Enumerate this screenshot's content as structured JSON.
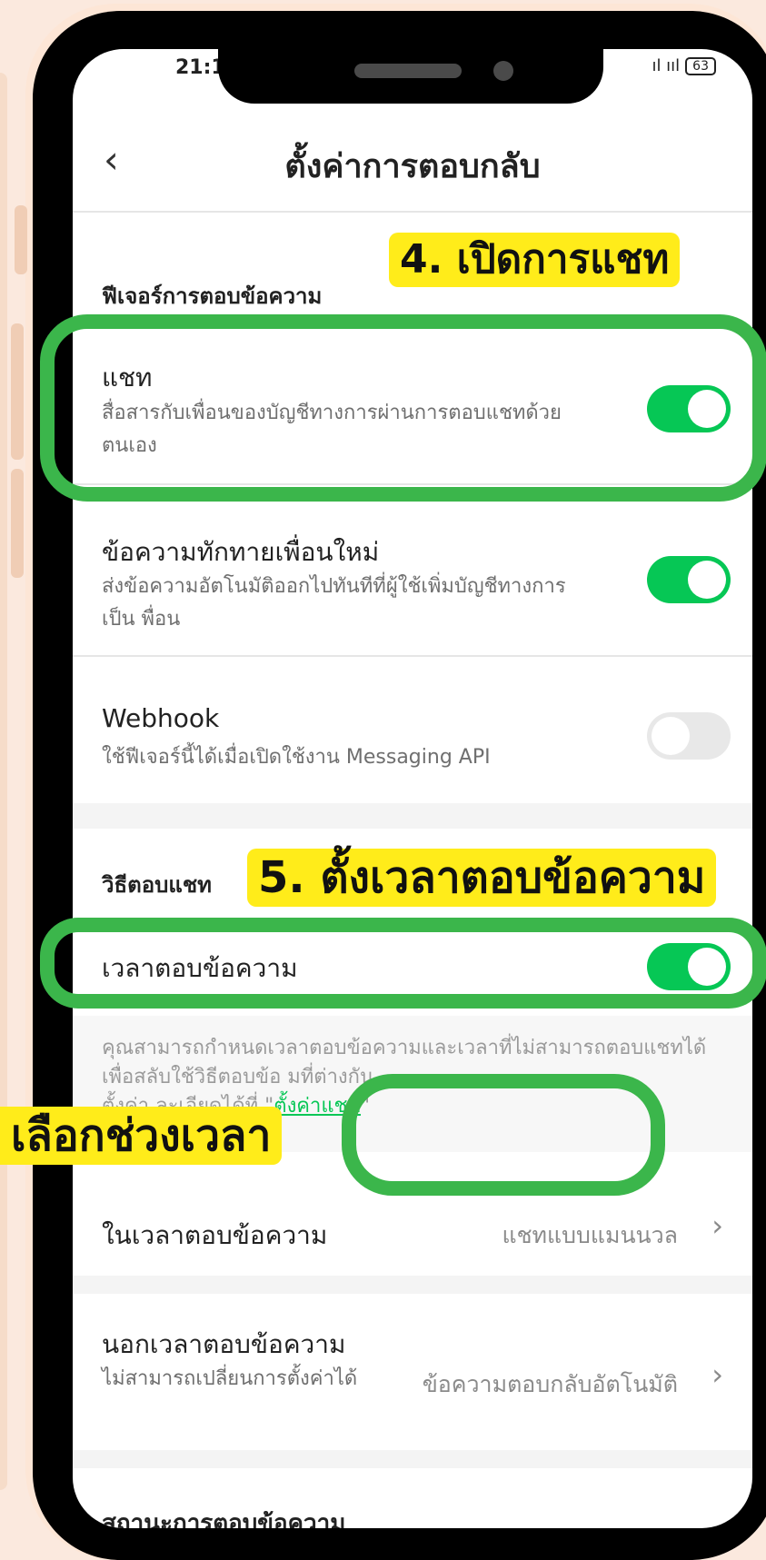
{
  "status": {
    "time": "21:1",
    "signal": "ıl ııl",
    "battery": "63"
  },
  "header": {
    "title": "ตั้งค่าการตอบกลับ"
  },
  "features": {
    "section_label": "ฟีเจอร์การตอบข้อความ",
    "chat": {
      "title": "แชท",
      "desc": "สื่อสารกับเพื่อนของบัญชีทางการผ่านการตอบแชทด้วยตนเอง",
      "enabled": true
    },
    "greeting": {
      "title": "ข้อความทักทายเพื่อนใหม่",
      "desc": "ส่งข้อความอัตโนมัติออกไปทันทีที่ผู้ใช้เพิ่มบัญชีทางการเป็น  พื่อน",
      "enabled": true
    },
    "webhook": {
      "title": "Webhook",
      "desc": "ใช้ฟีเจอร์นี้ได้เมื่อเปิดใช้งาน Messaging API",
      "enabled": false
    }
  },
  "reply_method": {
    "section_label": "วิธีตอบแชท",
    "response_hours": {
      "title": "เวลาตอบข้อความ",
      "enabled": true
    },
    "note_line1": "คุณสามารถกำหนดเวลาตอบข้อความและเวลาที่ไม่สามารถตอบแชทได้เพื่อสลับใช้วิธีตอบข้อ   มที่ต่างกัน",
    "note_line2_prefix": "ตั้งค่า                    ละเอียดได้ที่ \"",
    "note_link": "ตั้งค่าแชท",
    "note_line2_suffix": "\"",
    "in_hours": {
      "title": "ในเวลาตอบข้อความ",
      "value": "แชทแบบแมนนวล"
    },
    "out_hours": {
      "title": "นอกเวลาตอบข้อความ",
      "desc": "ไม่สามารถเปลี่ยนการตั้งค่าได้",
      "value": "ข้อความตอบกลับอัตโนมัติ"
    },
    "partial_section": "สถานะการตอบข้อความ"
  },
  "annotations": {
    "step4": "4. เปิดการแชท",
    "step5": "5. ตั้งเวลาตอบข้อความ",
    "select_time": "เลือกช่วงเวลา"
  },
  "colors": {
    "accent": "#06c755",
    "annotation_ring": "#3bb64b",
    "callout_bg": "#ffec1a",
    "frame": "#000000",
    "page_bg": "#fbe9de"
  }
}
